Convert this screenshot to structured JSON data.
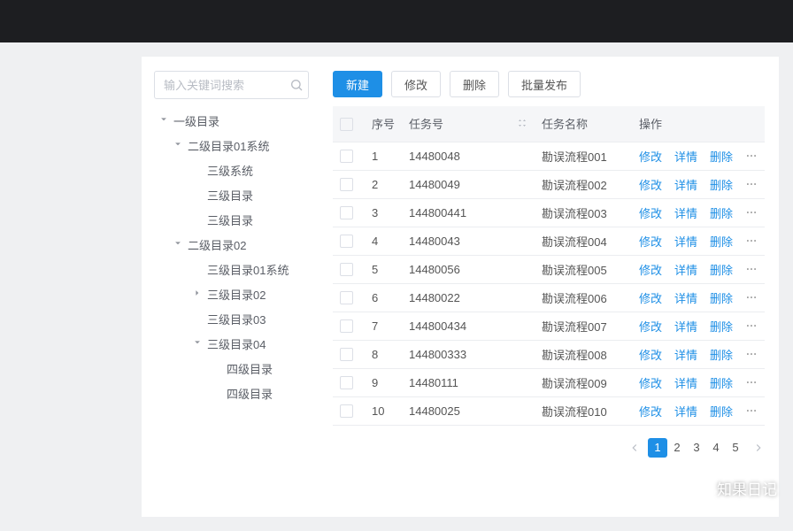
{
  "sidebar": {
    "search_placeholder": "输入关键词搜索",
    "tree": {
      "root": {
        "label": "一级目录",
        "expanded": true
      },
      "l2a": {
        "label": "二级目录01系统",
        "expanded": true
      },
      "l2a_children": [
        "三级系统",
        "三级目录",
        "三级目录"
      ],
      "l2b": {
        "label": "二级目录02",
        "expanded": true
      },
      "l2b_c1": {
        "label": "三级目录01系统",
        "type": "leaf"
      },
      "l2b_c2": {
        "label": "三级目录02",
        "type": "collapsed"
      },
      "l2b_c3": {
        "label": "三级目录03",
        "type": "leaf"
      },
      "l2b_c4": {
        "label": "三级目录04",
        "type": "expanded"
      },
      "l2b_c4_children": [
        "四级目录",
        "四级目录"
      ]
    }
  },
  "toolbar": {
    "create_label": "新建",
    "edit_label": "修改",
    "delete_label": "删除",
    "batch_publish_label": "批量发布"
  },
  "table": {
    "headers": {
      "seq": "序号",
      "task_no": "任务号",
      "task_name": "任务名称",
      "ops": "操作"
    },
    "action_labels": {
      "edit": "修改",
      "detail": "详情",
      "delete": "删除"
    },
    "rows": [
      {
        "seq": 1,
        "task_no": "14480048",
        "task_name": "勘误流程001"
      },
      {
        "seq": 2,
        "task_no": "14480049",
        "task_name": "勘误流程002"
      },
      {
        "seq": 3,
        "task_no": "144800441",
        "task_name": "勘误流程003"
      },
      {
        "seq": 4,
        "task_no": "14480043",
        "task_name": "勘误流程004"
      },
      {
        "seq": 5,
        "task_no": "14480056",
        "task_name": "勘误流程005"
      },
      {
        "seq": 6,
        "task_no": "14480022",
        "task_name": "勘误流程006"
      },
      {
        "seq": 7,
        "task_no": "144800434",
        "task_name": "勘误流程007"
      },
      {
        "seq": 8,
        "task_no": "144800333",
        "task_name": "勘误流程008"
      },
      {
        "seq": 9,
        "task_no": "14480111",
        "task_name": "勘误流程009"
      },
      {
        "seq": 10,
        "task_no": "14480025",
        "task_name": "勘误流程010"
      }
    ]
  },
  "pagination": {
    "pages": [
      1,
      2,
      3,
      4,
      5
    ],
    "current": 1
  },
  "watermark": "知果日记"
}
